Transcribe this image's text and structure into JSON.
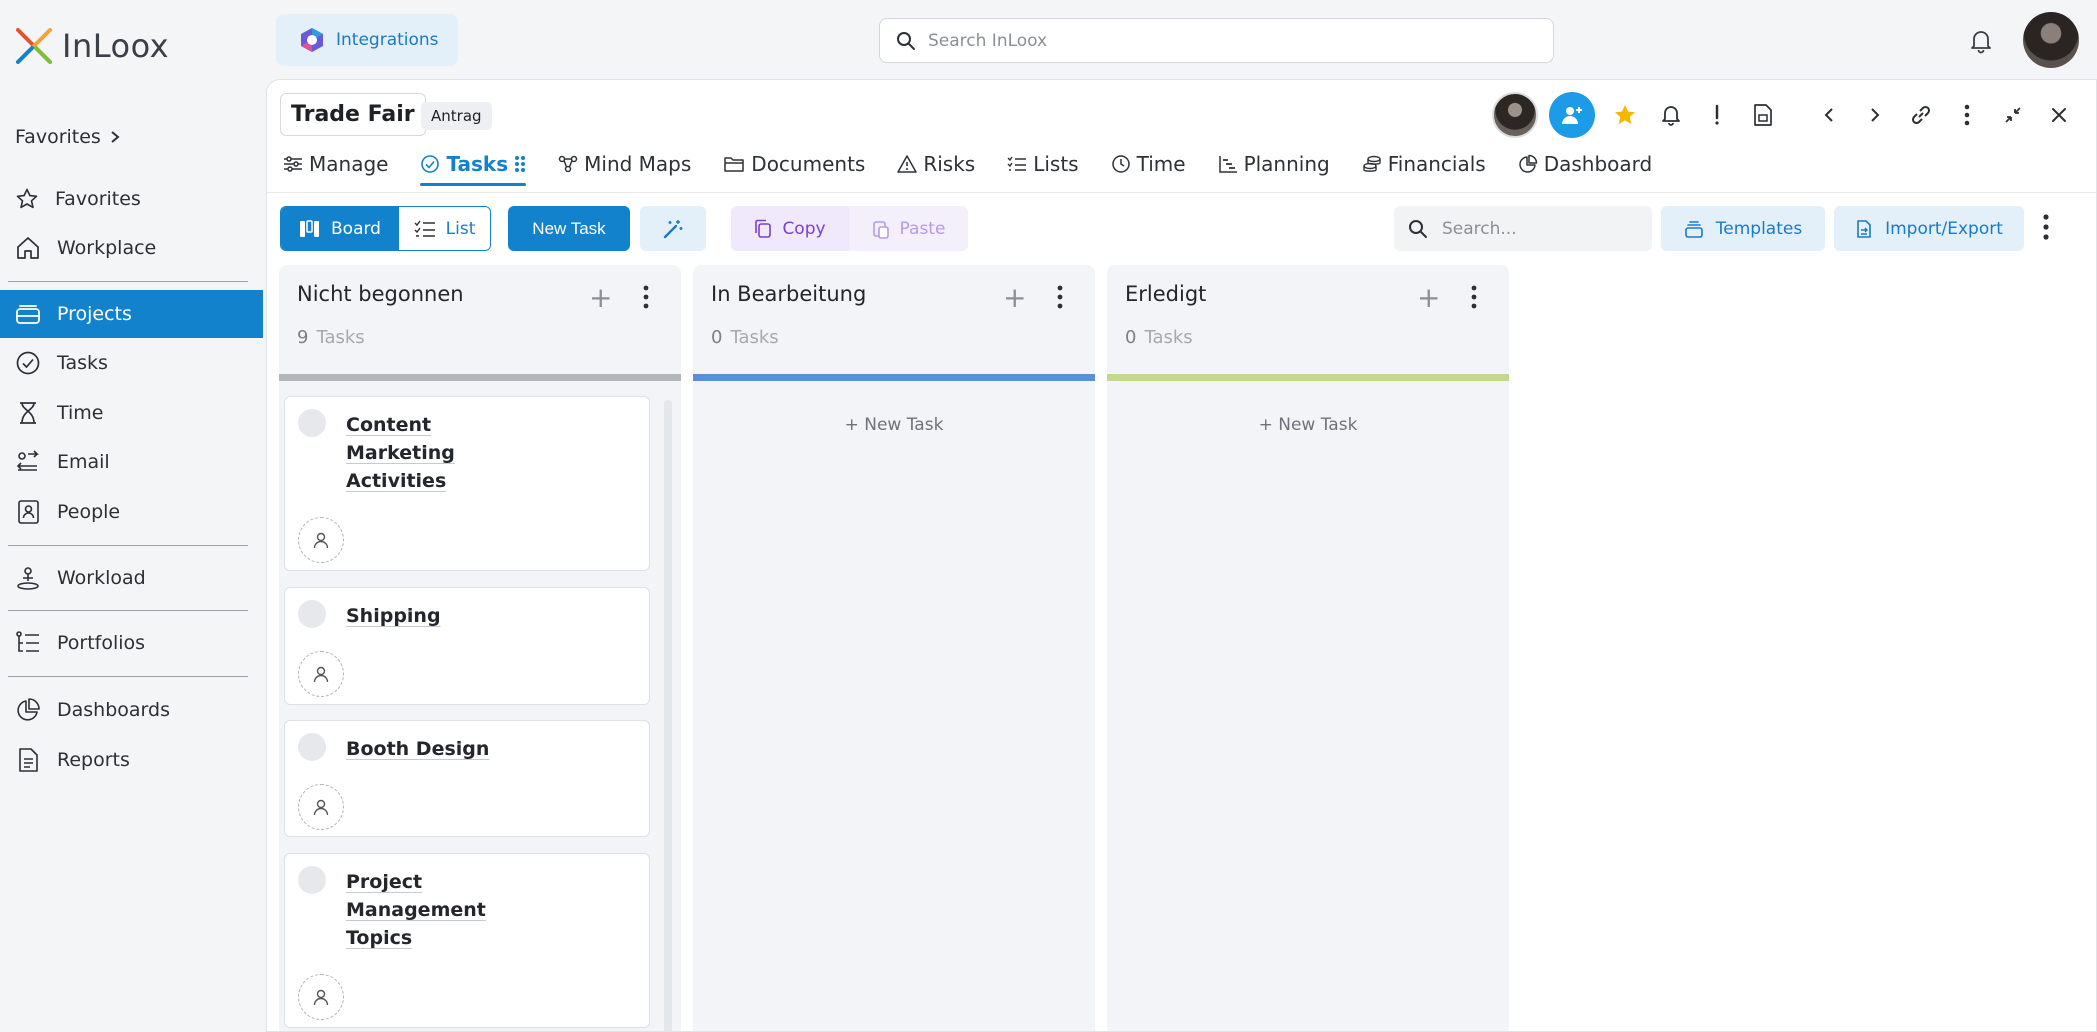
{
  "app": {
    "logo_text": "InLoox",
    "integrations_label": "Integrations",
    "search_placeholder": "Search InLoox"
  },
  "sidebar": {
    "favorites_header": "Favorites",
    "items": [
      {
        "label": "Favorites"
      },
      {
        "label": "Workplace"
      },
      {
        "label": "Projects"
      },
      {
        "label": "Tasks"
      },
      {
        "label": "Time"
      },
      {
        "label": "Email"
      },
      {
        "label": "People"
      },
      {
        "label": "Workload"
      },
      {
        "label": "Portfolios"
      },
      {
        "label": "Dashboards"
      },
      {
        "label": "Reports"
      }
    ],
    "active": "Projects"
  },
  "project": {
    "title": "Trade Fair",
    "badge": "Antrag"
  },
  "tabs": [
    {
      "label": "Manage"
    },
    {
      "label": "Tasks"
    },
    {
      "label": "Mind Maps"
    },
    {
      "label": "Documents"
    },
    {
      "label": "Risks"
    },
    {
      "label": "Lists"
    },
    {
      "label": "Time"
    },
    {
      "label": "Planning"
    },
    {
      "label": "Financials"
    },
    {
      "label": "Dashboard"
    }
  ],
  "active_tab": "Tasks",
  "toolbar": {
    "board_label": "Board",
    "list_label": "List",
    "new_task_label": "New Task",
    "copy_label": "Copy",
    "paste_label": "Paste",
    "search_placeholder": "Search...",
    "templates_label": "Templates",
    "import_export_label": "Import/Export"
  },
  "columns": [
    {
      "title": "Nicht begonnen",
      "count": "9",
      "count_label": "Tasks",
      "bar_color": "#b3b6bb",
      "cards": [
        {
          "title": "Content Marketing Activities"
        },
        {
          "title": "Shipping"
        },
        {
          "title": "Booth Design"
        },
        {
          "title": "Project Management Topics"
        }
      ]
    },
    {
      "title": "In Bearbeitung",
      "count": "0",
      "count_label": "Tasks",
      "bar_color": "#5b8fd6",
      "new_task_label": "New Task"
    },
    {
      "title": "Erledigt",
      "count": "0",
      "count_label": "Tasks",
      "bar_color": "#c4d98f",
      "new_task_label": "New Task"
    }
  ],
  "colors": {
    "accent": "#1382cd",
    "favorite_star": "#f5b800"
  }
}
